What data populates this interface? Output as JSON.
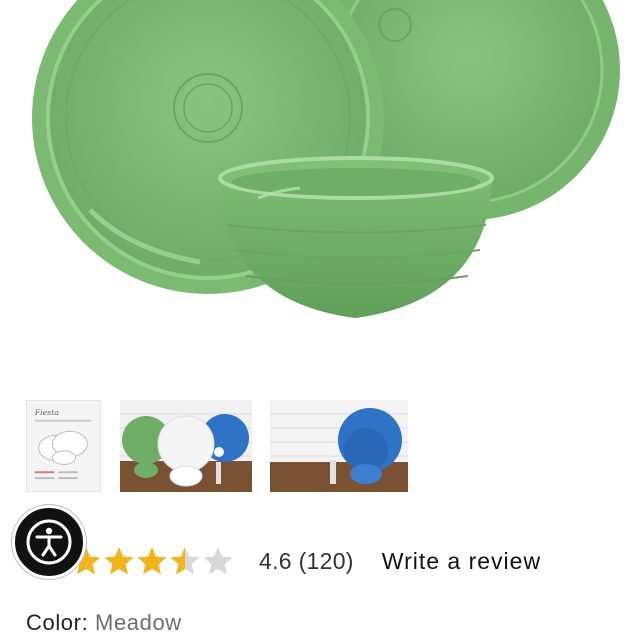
{
  "gallery": {
    "thumbnails": [
      {
        "name": "spec-sheet",
        "brand": "Fiesta"
      },
      {
        "name": "lifestyle-green-white-blue"
      },
      {
        "name": "lifestyle-blue"
      }
    ]
  },
  "accessibility": {
    "icon": "accessibility-person-icon"
  },
  "rating": {
    "score": 4.6,
    "value_text": "4.6",
    "count_text": "(120)",
    "stars_filled": 3.5,
    "stars_total": 5,
    "star_color": "#f3b31b",
    "star_empty_color": "#d8d8d8"
  },
  "review": {
    "write_label": "Write a review"
  },
  "color": {
    "label": "Color:",
    "value": "Meadow"
  },
  "colors": {
    "meadow": "#7dbd74",
    "cobalt": "#2f73c6"
  }
}
